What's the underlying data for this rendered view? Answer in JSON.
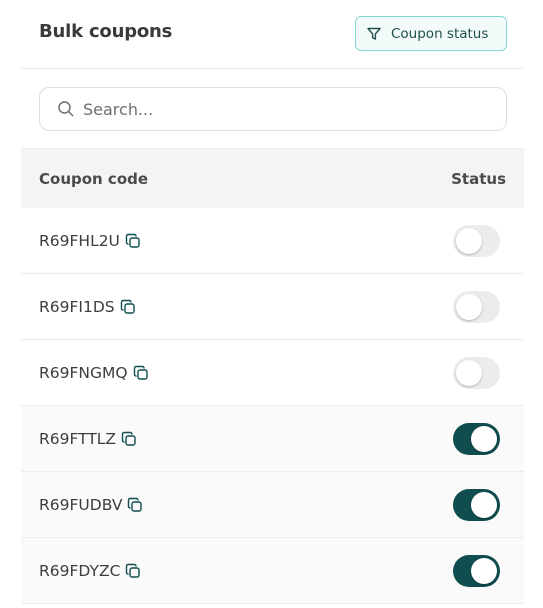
{
  "header": {
    "title": "Bulk coupons",
    "filter_label": "Coupon status"
  },
  "search": {
    "placeholder": "Search..."
  },
  "table": {
    "columns": [
      "Coupon code",
      "Status"
    ],
    "rows": [
      {
        "code": "R69FHL2U",
        "active": false
      },
      {
        "code": "R69FI1DS",
        "active": false
      },
      {
        "code": "R69FNGMQ",
        "active": false
      },
      {
        "code": "R69FTTLZ",
        "active": true
      },
      {
        "code": "R69FUDBV",
        "active": true
      },
      {
        "code": "R69FDYZC",
        "active": true
      }
    ]
  },
  "icons": {
    "filter": "filter-icon",
    "search": "search-icon",
    "copy": "copy-icon"
  },
  "colors": {
    "accent": "#0f4d4f",
    "filter_border": "#80d8cf",
    "toggle_off": "#ececec"
  }
}
